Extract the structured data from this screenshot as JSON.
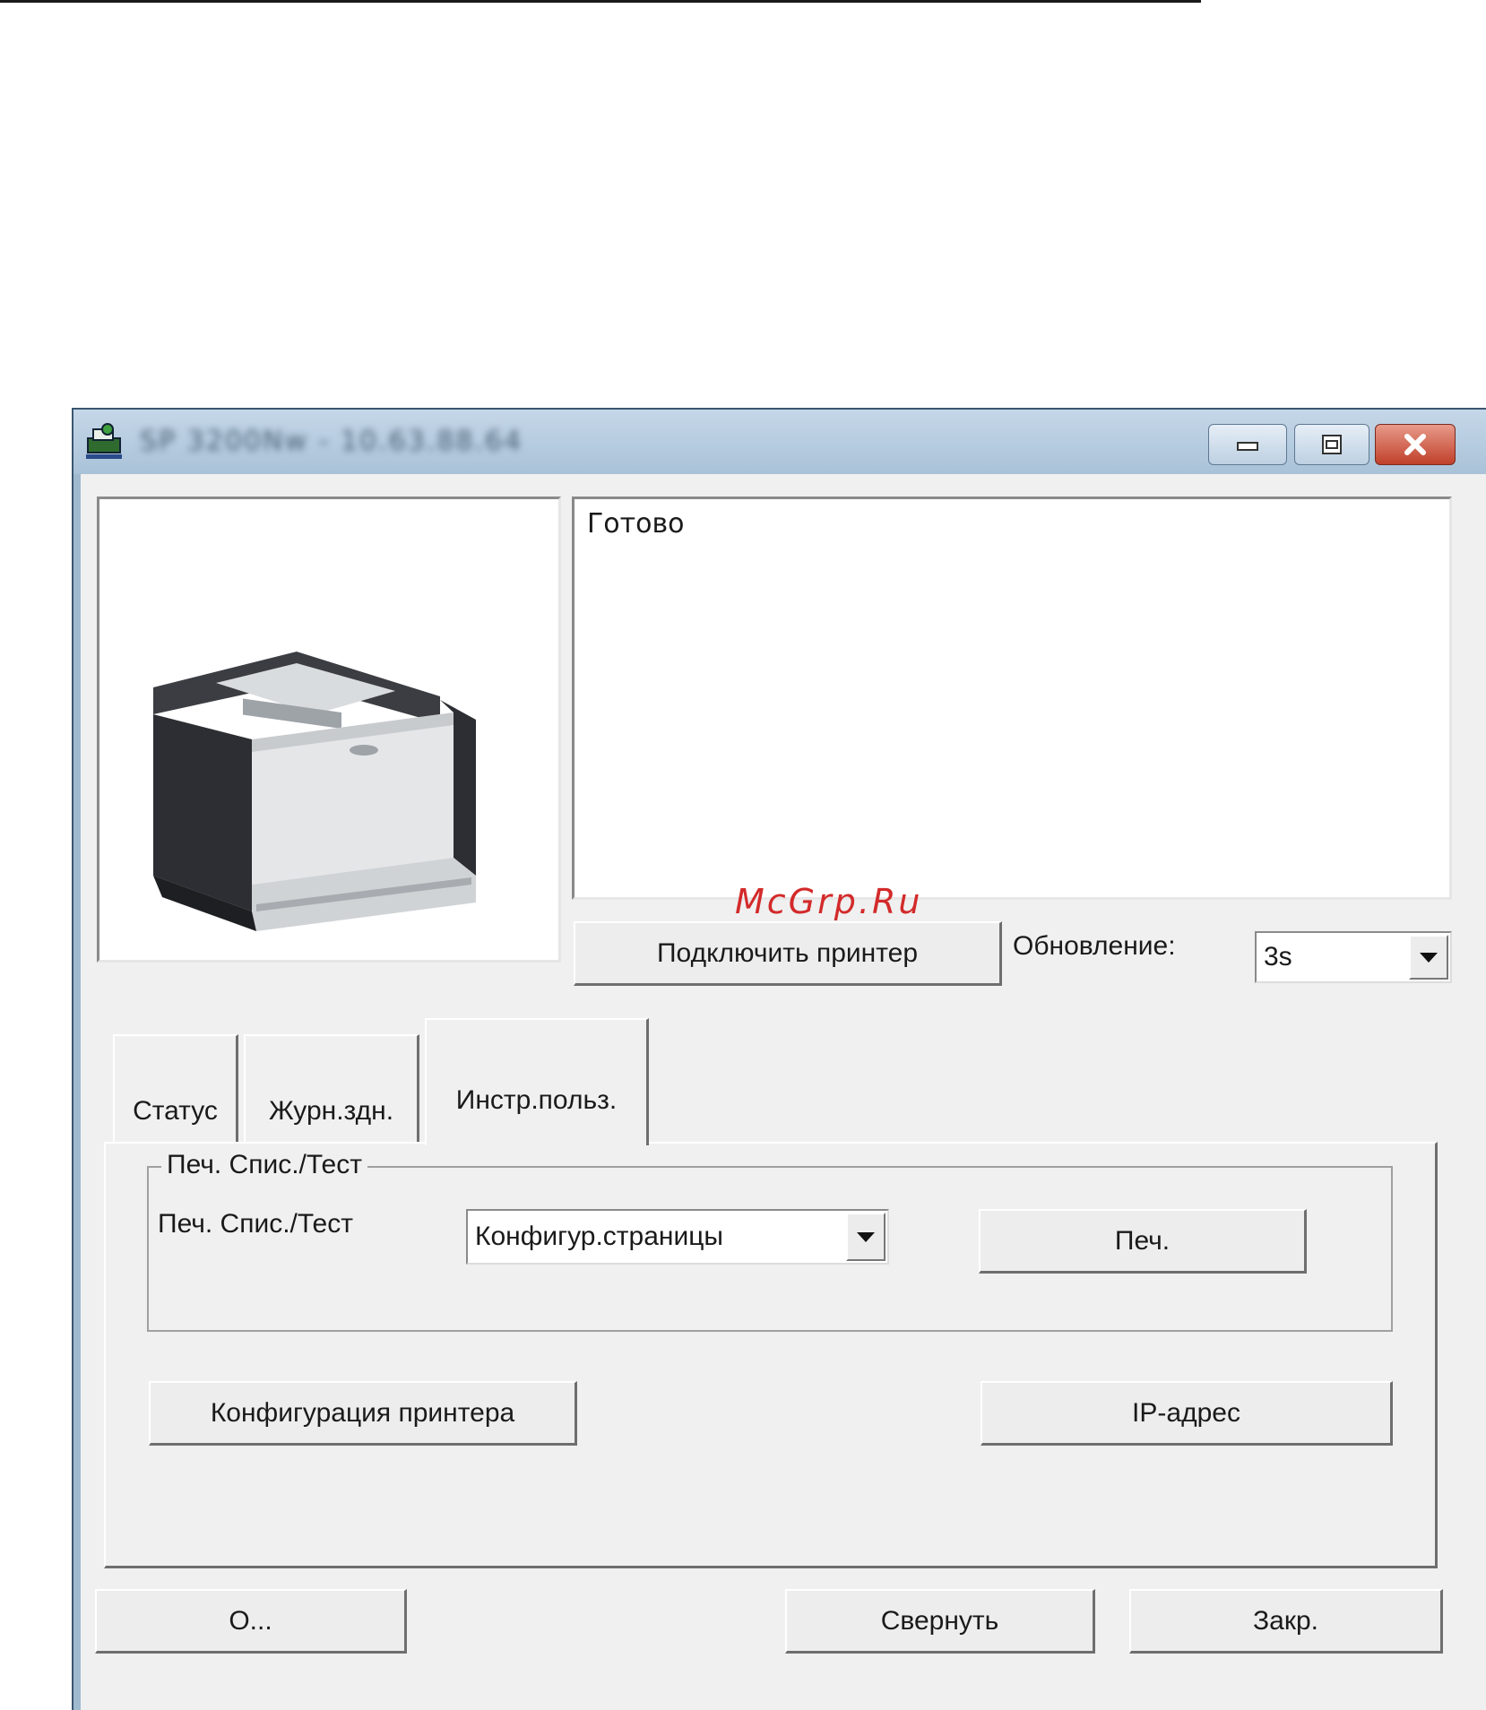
{
  "window": {
    "title": "SP 3200Nw - 10.63.88.64"
  },
  "status": {
    "message": "Готово"
  },
  "watermark": "McGrp.Ru",
  "connect_button": "Подключить принтер",
  "refresh": {
    "label": "Обновление:",
    "value": "3s"
  },
  "tabs": [
    {
      "label": "Статус",
      "active": false
    },
    {
      "label": "Журн.здн.",
      "active": false
    },
    {
      "label": "Инстр.польз.",
      "active": true
    }
  ],
  "print_list_group": {
    "title": "Печ. Спис./Тест",
    "field_label": "Печ. Спис./Тест",
    "selected": "Конфигур.страницы",
    "print_button": "Печ."
  },
  "printer_config_button": "Конфигурация принтера",
  "ip_address_button": "IP-адрес",
  "footer": {
    "about_button": "О...",
    "minimize_button": "Свернуть",
    "close_button": "Закр."
  },
  "colors": {
    "titlebar": "#b5cce0",
    "client_bg": "#f0f0f0",
    "close_red": "#c0402a",
    "watermark": "#d32a2a"
  }
}
